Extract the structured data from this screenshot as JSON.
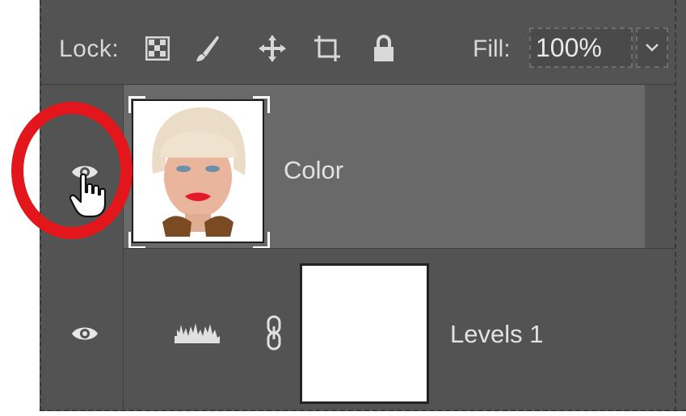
{
  "lock_bar": {
    "lock_label": "Lock:",
    "icons": [
      "lock-transparent-pixels-icon",
      "lock-image-pixels-icon",
      "lock-position-icon",
      "lock-artboard-icon",
      "lock-all-icon"
    ],
    "fill_label": "Fill:",
    "fill_value": "100%"
  },
  "layers": [
    {
      "name": "Color",
      "visible": true,
      "selected": true,
      "thumbnail": "portrait-photo-thumbnail"
    },
    {
      "name": "Levels 1",
      "visible": true,
      "selected": false,
      "thumbnail": "levels-adjustment-icon"
    }
  ],
  "colors": {
    "panel_bg": "#535353",
    "selected_row": "#696969",
    "annotation_red": "#e3161b"
  }
}
